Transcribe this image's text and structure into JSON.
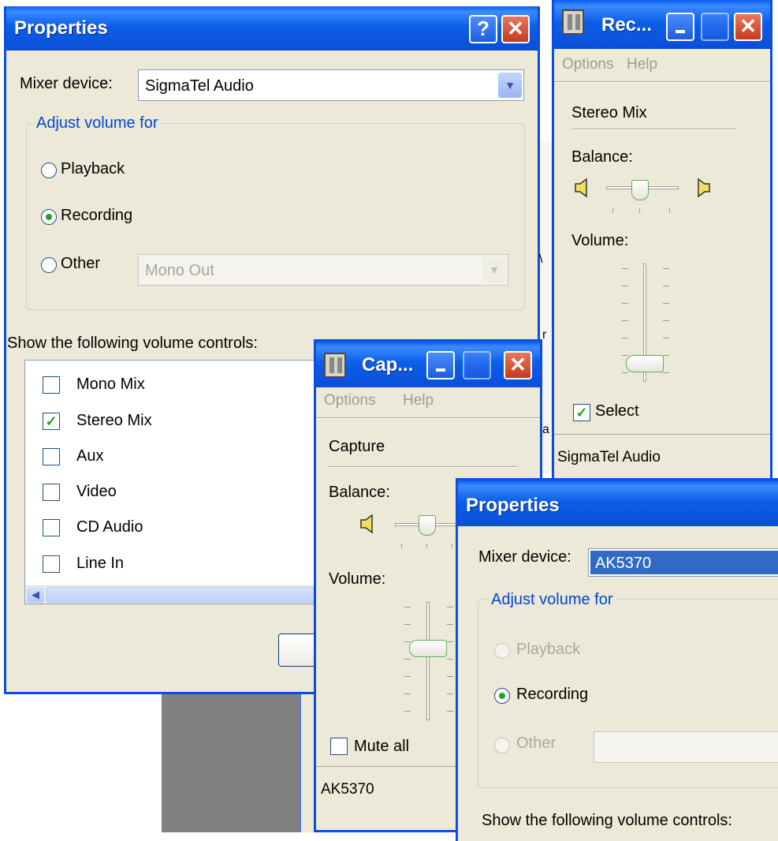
{
  "background_window": {
    "fragments": [
      "a",
      "r",
      "\\"
    ]
  },
  "properties1": {
    "title": "Properties",
    "help_btn": "?",
    "close_btn": "✕",
    "mixer_label": "Mixer device:",
    "mixer_value": "SigmaTel Audio",
    "group_label": "Adjust volume for",
    "radios": [
      {
        "label": "Playback",
        "selected": false
      },
      {
        "label": "Recording",
        "selected": true
      },
      {
        "label": "Other",
        "selected": false
      }
    ],
    "other_value": "Mono Out",
    "show_label": "Show the following volume controls:",
    "controls": [
      {
        "label": "Mono Mix",
        "checked": false
      },
      {
        "label": "Stereo Mix",
        "checked": true
      },
      {
        "label": "Aux",
        "checked": false
      },
      {
        "label": "Video",
        "checked": false
      },
      {
        "label": "CD Audio",
        "checked": false
      },
      {
        "label": "Line In",
        "checked": false
      }
    ]
  },
  "recording_control": {
    "title": "Rec...",
    "menu": [
      "Options",
      "Help"
    ],
    "channel": "Stereo Mix",
    "balance_label": "Balance:",
    "volume_label": "Volume:",
    "select_label": "Select",
    "select_checked": true,
    "device": "SigmaTel Audio"
  },
  "capture_control": {
    "title": "Cap...",
    "menu": [
      "Options",
      "Help"
    ],
    "channel": "Capture",
    "balance_label": "Balance:",
    "volume_label": "Volume:",
    "mute_label": "Mute all",
    "mute_checked": false,
    "device": "AK5370"
  },
  "properties2": {
    "title": "Properties",
    "mixer_label": "Mixer device:",
    "mixer_value": "AK5370",
    "group_label": "Adjust volume for",
    "radios": [
      {
        "label": "Playback",
        "selected": false,
        "disabled": true
      },
      {
        "label": "Recording",
        "selected": true,
        "disabled": false
      },
      {
        "label": "Other",
        "selected": false,
        "disabled": true
      }
    ],
    "show_label": "Show the following volume controls:"
  },
  "colors": {
    "face": "#ece9d8",
    "titlebar": "#0a5cf0",
    "accent": "#0046d5",
    "check": "#21a121",
    "close": "#c43b1e"
  }
}
